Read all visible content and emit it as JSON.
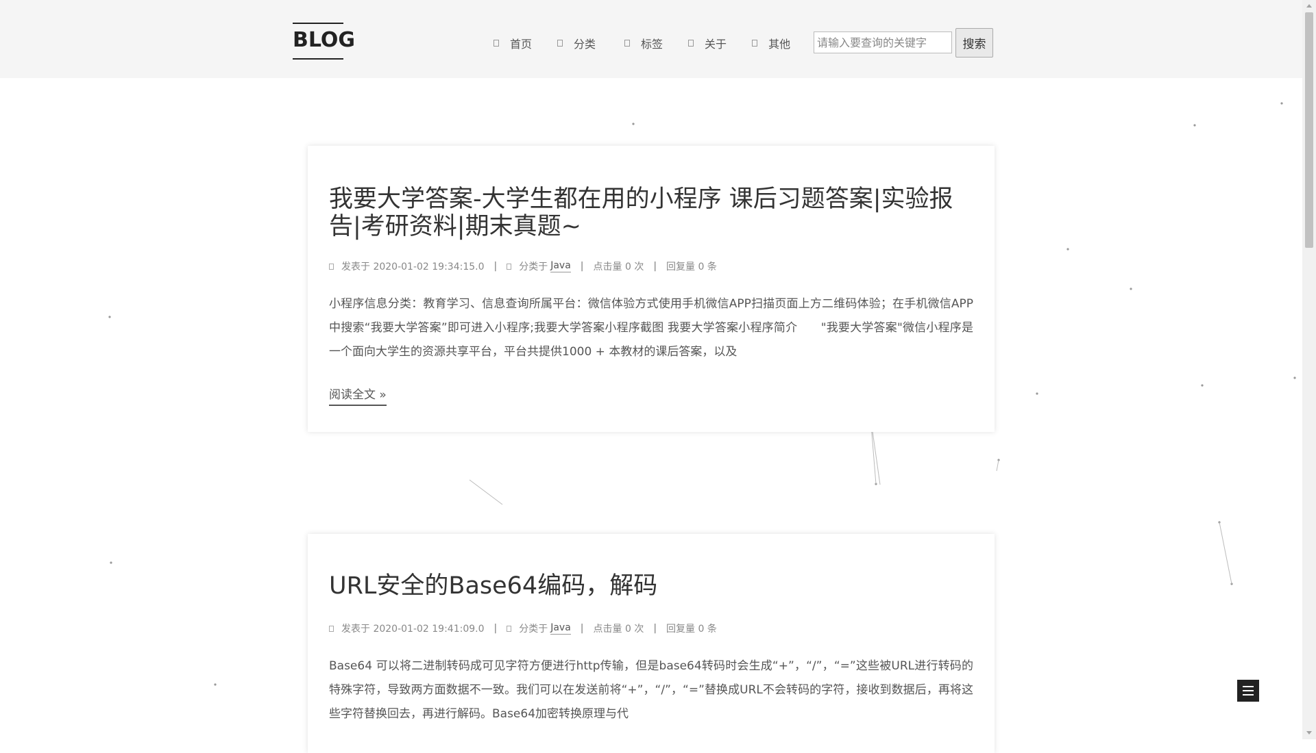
{
  "header": {
    "logo": "BLOG",
    "nav": [
      {
        "label": "首页",
        "icon": "home-icon"
      },
      {
        "label": "分类",
        "icon": "category-icon"
      },
      {
        "label": "标签",
        "icon": "tag-icon"
      },
      {
        "label": "关于",
        "icon": "user-icon"
      },
      {
        "label": "其他",
        "icon": "more-icon"
      }
    ],
    "search": {
      "placeholder": "请输入要查询的关键字",
      "button": "搜索"
    }
  },
  "posts": [
    {
      "title": "我要大学答案-大学生都在用的小程序 课后习题答案|实验报告|考研资料|期末真题~",
      "date": "发表于 2020-01-02 19:34:15.0",
      "category_prefix": "分类于",
      "category": "Java",
      "views": "点击量 0 次",
      "replies": "回复量 0 条",
      "excerpt": "小程序信息分类：教育学习、信息查询所属平台：微信体验方式使用手机微信APP扫描页面上方二维码体验；在手机微信APP中搜索“我要大学答案”即可进入小程序;我要大学答案小程序截图 我要大学答案小程序简介　　\"我要大学答案\"微信小程序是一个面向大学生的资源共享平台，平台共提供1000 + 本教材的课后答案，以及",
      "read_more": "阅读全文 »"
    },
    {
      "title": "URL安全的Base64编码，解码",
      "date": "发表于 2020-01-02 19:41:09.0",
      "category_prefix": "分类于",
      "category": "Java",
      "views": "点击量 0 次",
      "replies": "回复量 0 条",
      "excerpt": "Base64 可以将二进制转码成可见字符方便进行http传输，但是base64转码时会生成“+”，“/”，“=”这些被URL进行转码的特殊字符，导致两方面数据不一致。我们可以在发送前将“+”，“/”，“=”替换成URL不会转码的字符，接收到数据后，再将这些字符替换回去，再进行解码。Base64加密转换原理与代"
    }
  ],
  "ui": {
    "menu_icon": "menu-icon",
    "accent": "#222222",
    "header_bg": "#f5f5f5"
  }
}
